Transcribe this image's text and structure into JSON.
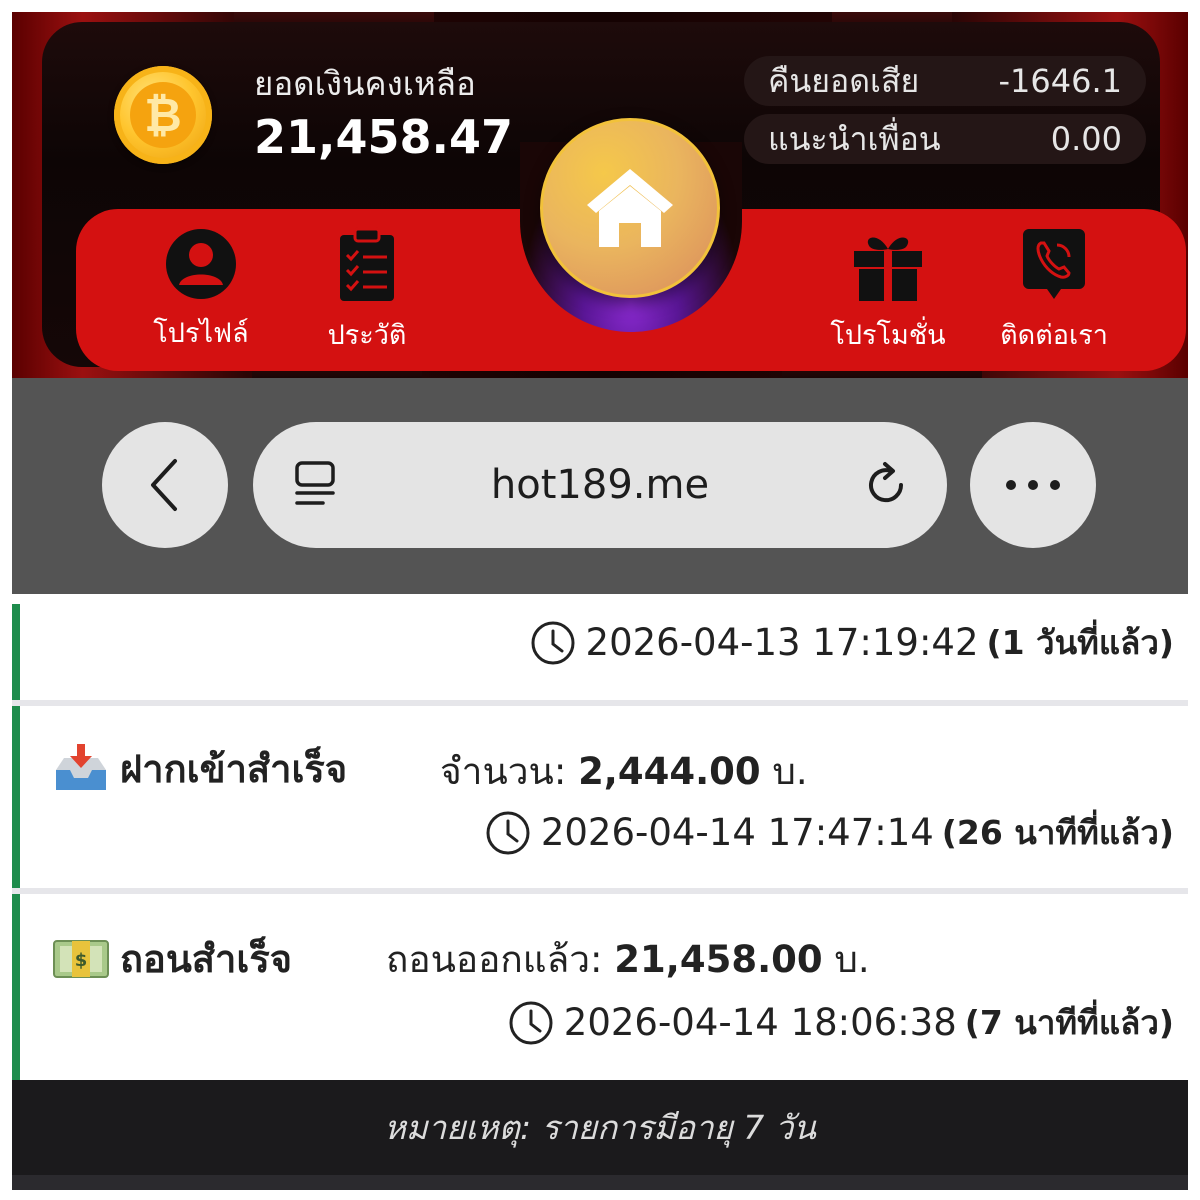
{
  "wallet": {
    "balance_label": "ยอดเงินคงเหลือ",
    "balance_value": "21,458.47",
    "cashback_label": "คืนยอดเสีย",
    "cashback_value": "-1646.1",
    "referral_label": "แนะนำเพื่อน",
    "referral_value": "0.00",
    "coin_symbol": "₿"
  },
  "nav": {
    "items": [
      {
        "label": "โปรไฟล์",
        "icon": "user-icon"
      },
      {
        "label": "ประวัติ",
        "icon": "clipboard-list-icon"
      },
      {
        "label": "โปรโมชั่น",
        "icon": "gift-icon"
      },
      {
        "label": "ติดต่อเรา",
        "icon": "phone-chat-icon"
      }
    ],
    "home_icon": "home-icon"
  },
  "browser": {
    "url": "hot189.me",
    "back_icon": "chevron-left-icon",
    "reader_icon": "reader-mode-icon",
    "reload_icon": "reload-icon",
    "more_icon": "more-dots-icon"
  },
  "transactions": [
    {
      "title": "",
      "amount_label": "",
      "amount_value": "",
      "unit": "",
      "datetime": "2026-04-13 17:19:42",
      "ago": "(1 วันที่แล้ว)"
    },
    {
      "title": "ฝากเข้าสำเร็จ",
      "icon": "inbox-tray-icon",
      "amount_label": "จำนวน:",
      "amount_value": "2,444.00",
      "unit": "บ.",
      "datetime": "2026-04-14 17:47:14",
      "ago": "(26 นาทีที่แล้ว)"
    },
    {
      "title": "ถอนสำเร็จ",
      "icon": "dollar-banknote-icon",
      "amount_label": "ถอนออกแล้ว:",
      "amount_value": "21,458.00",
      "unit": "บ.",
      "datetime": "2026-04-14 18:06:38",
      "ago": "(7 นาทีที่แล้ว)"
    }
  ],
  "note": "หมายเหตุ: รายการมีอายุ 7 วัน",
  "colors": {
    "nav_red": "#d41111",
    "accent_green": "#1e8c4c",
    "coin_gold": "#ffc52e"
  }
}
